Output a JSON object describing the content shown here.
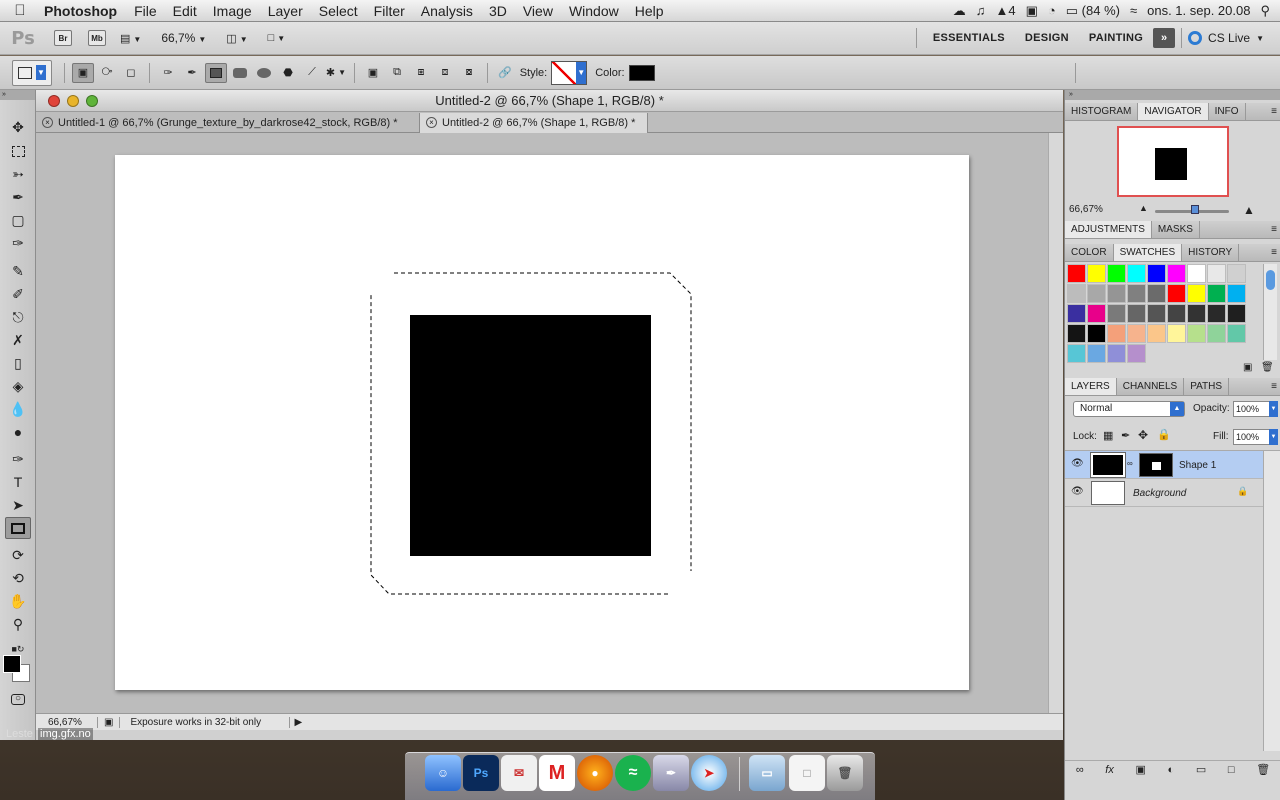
{
  "menubar": {
    "app": "Photoshop",
    "items": [
      "File",
      "Edit",
      "Image",
      "Layer",
      "Select",
      "Filter",
      "Analysis",
      "3D",
      "View",
      "Window",
      "Help"
    ],
    "status": {
      "adobe_badge": "4",
      "battery": "(84 %)",
      "datetime": "ons. 1. sep. 20.08"
    }
  },
  "appbar": {
    "ps_logo": "Ps",
    "br": "Br",
    "mb": "Mb",
    "zoom": "66,7%",
    "workspaces": [
      "ESSENTIALS",
      "DESIGN",
      "PAINTING"
    ],
    "cslive": "CS Live"
  },
  "optbar": {
    "style_label": "Style:",
    "color_label": "Color:",
    "fg_color": "#000000"
  },
  "document": {
    "title": "Untitled-2 @ 66,7% (Shape 1, RGB/8) *",
    "tabs": [
      "Untitled-1 @ 66,7% (Grunge_texture_by_darkrose42_stock, RGB/8) *",
      "Untitled-2 @ 66,7% (Shape 1, RGB/8) *"
    ],
    "active_tab": 1,
    "status_zoom": "66,67%",
    "status_msg": "Exposure works in 32-bit only"
  },
  "panels": {
    "top_tabs": [
      "HISTOGRAM",
      "NAVIGATOR",
      "INFO"
    ],
    "nav_zoom": "66,67%",
    "adj_tabs": [
      "ADJUSTMENTS",
      "MASKS"
    ],
    "sw_tabs": [
      "COLOR",
      "SWATCHES",
      "HISTORY"
    ],
    "layers_tabs": [
      "LAYERS",
      "CHANNELS",
      "PATHS"
    ],
    "blend": "Normal",
    "opacity_label": "Opacity:",
    "opacity": "100%",
    "lock_label": "Lock:",
    "fill_label": "Fill:",
    "fill": "100%",
    "layers": [
      {
        "name": "Shape 1"
      },
      {
        "name": "Background"
      }
    ],
    "swatches": [
      "#ff0000",
      "#ffff00",
      "#00ff00",
      "#00ffff",
      "#0000ff",
      "#ff00ff",
      "#ffffff",
      "#e8e8e8",
      "#d0d0d0",
      "#bcbcbc",
      "#a8a8a8",
      "#959595",
      "#808080",
      "#6b6b6b",
      "#ff0000",
      "#ffff00",
      "#00b050",
      "#00b0f0",
      "#3a2fa0",
      "#e8008a",
      "#7a7a7a",
      "#666666",
      "#555555",
      "#444444",
      "#333333",
      "#292929",
      "#1f1f1f",
      "#141414",
      "#000000",
      "#f4a07a",
      "#f6b38d",
      "#fbc68a",
      "#fff59a",
      "#b6e08c",
      "#8fd39a",
      "#62c8a8",
      "#57c6d6",
      "#6aa8e2",
      "#8f8fd8",
      "#b58fcc"
    ]
  },
  "taskbar": {
    "status_text": "img.gfx.no",
    "left_text": "Leste"
  }
}
